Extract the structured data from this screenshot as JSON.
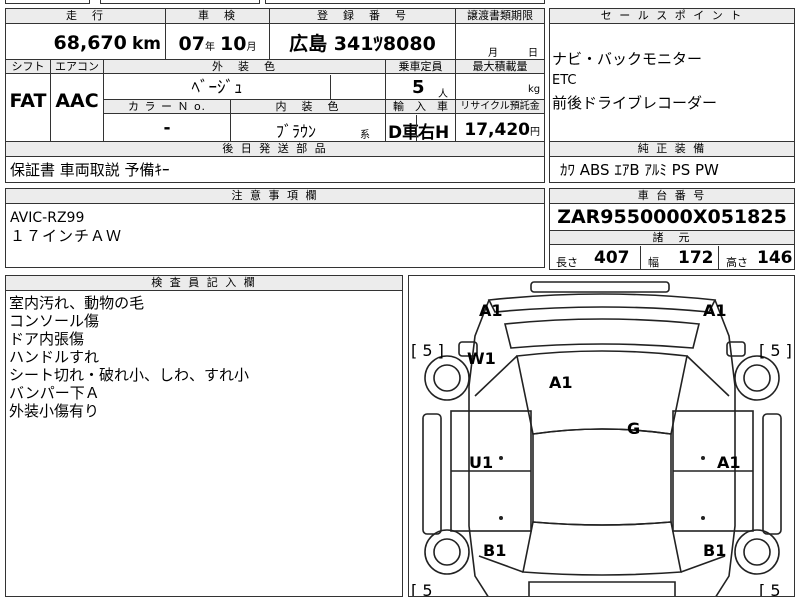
{
  "top_fragment": "",
  "header": {
    "mileage_label": "走　行",
    "inspection_label": "車　検",
    "registration_label": "登　録　番　号",
    "transfer_label": "譲渡書類期限"
  },
  "values": {
    "mileage_value": "68,670",
    "mileage_unit": "km",
    "inspection_year": "07",
    "year_unit": "年",
    "inspection_month": "10",
    "month_unit": "月",
    "registration": "広島 341ﾂ8080",
    "transfer_month_unit": "月",
    "transfer_day_unit": "日"
  },
  "specs": {
    "shift_label": "シフト",
    "aircon_label": "エアコン",
    "exterior_label": "外　装　色",
    "capacity_label": "乗車定員",
    "load_label": "最大積載量",
    "shift_value": "FAT",
    "aircon_value": "AAC",
    "exterior_value": "ﾍﾞｰｼﾞｭ",
    "capacity_value": "5",
    "capacity_unit": "人",
    "load_unit": "kg",
    "color_no_label": "カ ラ ー Ｎ o.",
    "interior_label": "内　装　色",
    "import_label": "輸　入　車",
    "recycle_label": "リサイクル預託金",
    "color_no_value": "-",
    "interior_value": "ﾌﾞﾗｳﾝ",
    "interior_suffix": "系",
    "import_value_1": "D車",
    "import_value_2": "右H",
    "recycle_value": "17,420",
    "recycle_unit": "円"
  },
  "later_parts": {
    "label": "後 日 発 送 部 品",
    "value": "保証書 車両取説 予備ｷｰ"
  },
  "sales_points": {
    "label": "セ ー ル ス ポ イ ン ト",
    "lines": [
      "ナビ・バックモニター",
      "ETC",
      "前後ドライブレコーダー"
    ]
  },
  "genuine": {
    "label": "純 正 装 備",
    "value": "ｶﾜ ABS ｴｱB ｱﾙﾐ PS PW"
  },
  "notes": {
    "label": "注 意 事 項 欄",
    "lines": [
      "AVIC-RZ99",
      "１７インチＡＷ"
    ]
  },
  "chassis": {
    "label": "車 台 番 号",
    "value": "ZAR9550000X051825"
  },
  "dimensions": {
    "label": "諸　元",
    "length_label": "長さ",
    "length_value": "407",
    "width_label": "幅",
    "width_value": "172",
    "height_label": "高さ",
    "height_value": "146"
  },
  "inspector": {
    "label": "検 査 員 記 入 欄",
    "lines": [
      "室内汚れ、動物の毛",
      "コンソール傷",
      "ドア内張傷",
      "ハンドルすれ",
      "シート切れ・破れ小、しわ、すれ小",
      "バンパー下Ａ",
      "外装小傷有り"
    ]
  },
  "diagram": {
    "marks": {
      "front_left": "A1",
      "front_right": "A1",
      "windshield_w": "W1",
      "windshield_a": "A1",
      "roof": "G",
      "left_door": "U1",
      "right_door": "A1",
      "rear_left": "B1",
      "rear_right": "B1"
    },
    "tire_depth": {
      "front_left": "[ 5 ]",
      "front_right": "[ 5 ]",
      "rear_left": "[ 5",
      "rear_right": "[ 5"
    }
  }
}
